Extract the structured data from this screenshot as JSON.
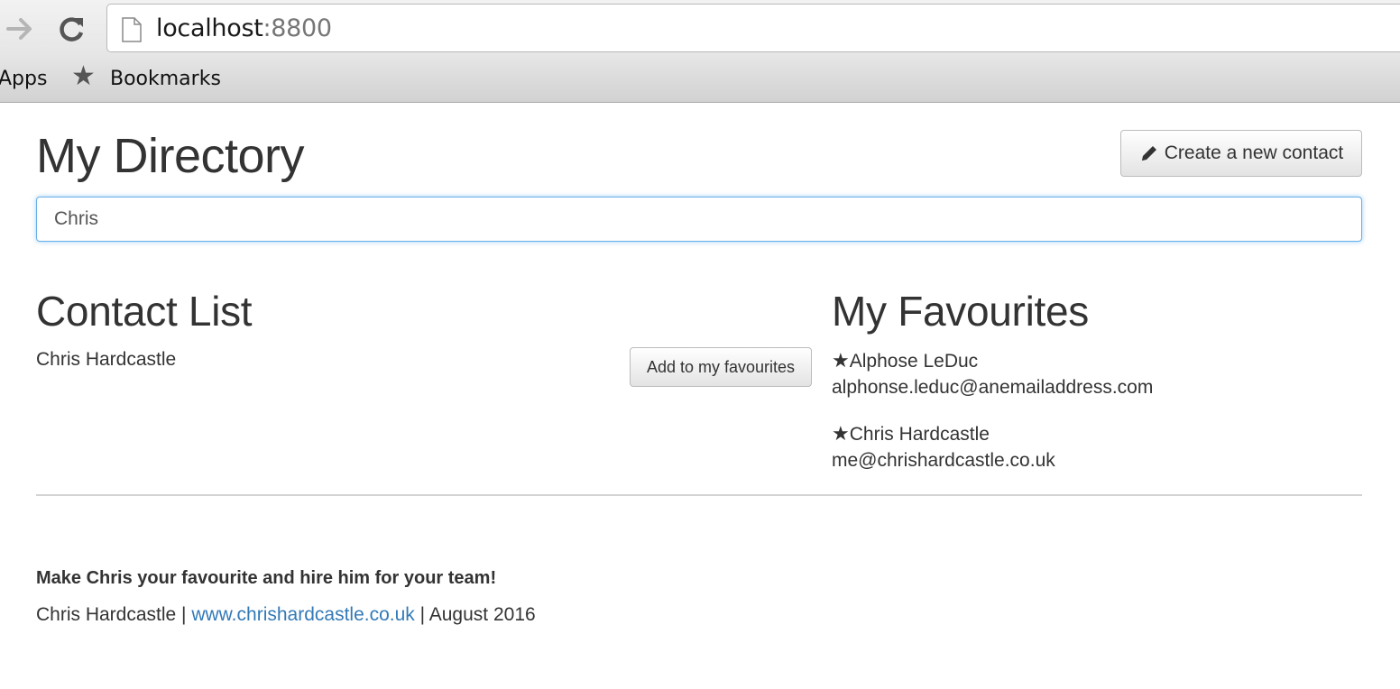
{
  "browser": {
    "url_host": "localhost",
    "url_port": ":8800",
    "bookmarks_bar": {
      "apps_label": "Apps",
      "bookmarks_label": "Bookmarks"
    }
  },
  "header": {
    "title": "My Directory",
    "create_button_label": "Create a new contact"
  },
  "search": {
    "value": "Chris"
  },
  "contact_list": {
    "heading": "Contact List",
    "items": [
      {
        "name": "Chris Hardcastle",
        "action_label": "Add to my favourites"
      }
    ]
  },
  "favourites": {
    "heading": "My Favourites",
    "star_glyph": "★",
    "items": [
      {
        "name": "Alphose LeDuc",
        "email": "alphonse.leduc@anemailaddress.com"
      },
      {
        "name": "Chris Hardcastle",
        "email": "me@chrishardcastle.co.uk"
      }
    ]
  },
  "footer": {
    "tagline": "Make Chris your favourite and hire him for your team!",
    "author": "Chris Hardcastle",
    "separator": " | ",
    "link_text": "www.chrishardcastle.co.uk",
    "date": "August 2016"
  },
  "colors": {
    "link": "#337ab7",
    "focus_border": "#66afe9",
    "text": "#333333"
  }
}
